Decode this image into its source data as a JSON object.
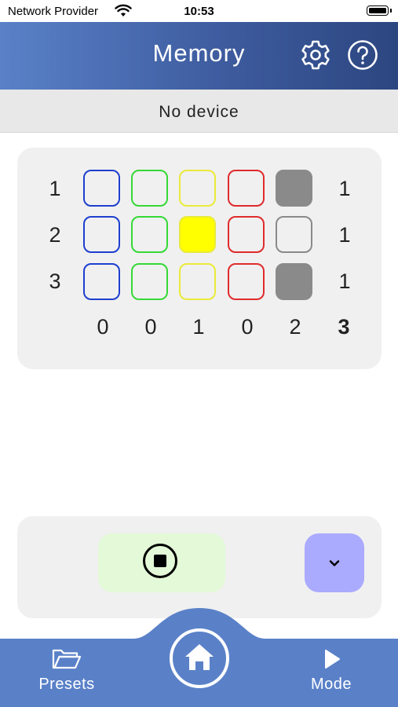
{
  "status_bar": {
    "carrier": "Network Provider",
    "time": "10:53"
  },
  "header": {
    "title": "Memory",
    "settings_icon": "gear-icon",
    "help_icon": "help-icon"
  },
  "device": {
    "status": "No device"
  },
  "grid": {
    "row_labels": [
      "1",
      "2",
      "3"
    ],
    "row_values": [
      "1",
      "1",
      "1"
    ],
    "column_values": [
      "0",
      "0",
      "1",
      "0",
      "2"
    ],
    "total": "3",
    "column_colors": [
      "#1e3fcf",
      "#35d935",
      "#eaea3a",
      "#e02b2b",
      "#8a8a8a"
    ],
    "rows": [
      [
        {
          "filled": false
        },
        {
          "filled": false
        },
        {
          "filled": false
        },
        {
          "filled": false
        },
        {
          "filled": true,
          "fill": "#8a8a8a"
        }
      ],
      [
        {
          "filled": false
        },
        {
          "filled": false
        },
        {
          "filled": true,
          "fill": "#ffff00"
        },
        {
          "filled": false
        },
        {
          "filled": false
        }
      ],
      [
        {
          "filled": false
        },
        {
          "filled": false
        },
        {
          "filled": false
        },
        {
          "filled": false
        },
        {
          "filled": true,
          "fill": "#8a8a8a"
        }
      ]
    ]
  },
  "controls": {
    "stop_icon": "stop-circle-icon",
    "dropdown_icon": "chevron-down-icon"
  },
  "tabs": {
    "presets": {
      "label": "Presets",
      "icon": "folder-icon"
    },
    "home": {
      "icon": "home-icon"
    },
    "mode": {
      "label": "Mode",
      "icon": "play-icon"
    }
  },
  "colors": {
    "accent": "#5a81c8",
    "header_dark": "#2c4680",
    "stop_bg": "#e3f9d8",
    "dropdown_bg": "#aaaaff"
  }
}
